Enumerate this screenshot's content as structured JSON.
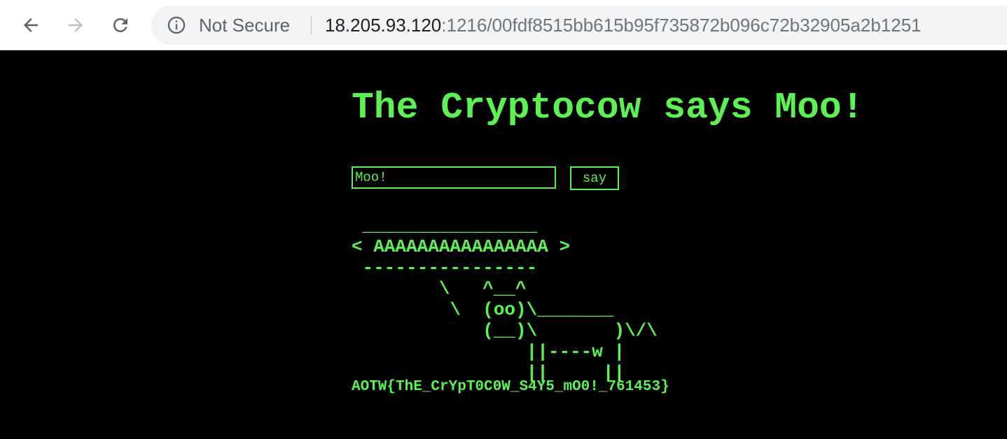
{
  "browser": {
    "security_label": "Not Secure",
    "url_host": "18.205.93.120",
    "url_rest": ":1216/00fdf8515bb615b95f735872b096c72b32905a2b1251"
  },
  "page": {
    "title": "The Cryptocow says Moo!",
    "input_value": "Moo!",
    "say_button": "say",
    "cow_output": " ________________\n< AAAAAAAAAAAAAAAA >\n ----------------\n        \\   ^__^\n         \\  (oo)\\_______\n            (__)\\       )\\/\\\n                ||----w |\n                ||     ||",
    "flag": "AOTW{ThE_CrYpT0C0W_S4Y5_mO0!_761453}"
  },
  "colors": {
    "terminal_green": "#5cf254",
    "background": "#000000"
  },
  "icons": [
    "back-arrow-icon",
    "forward-arrow-icon",
    "reload-icon",
    "info-icon"
  ]
}
